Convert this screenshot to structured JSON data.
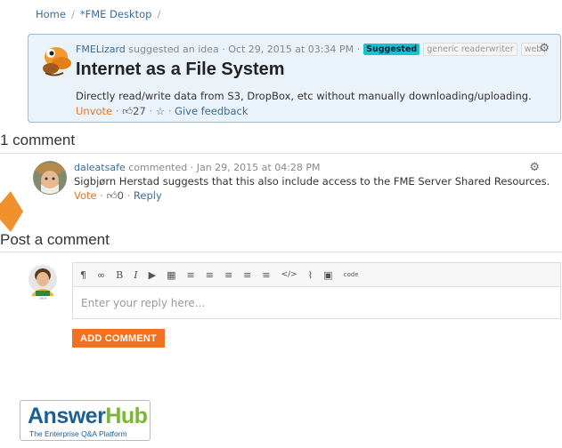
{
  "breadcrumb": {
    "home": "Home",
    "separator": "/",
    "current": "*FME Desktop"
  },
  "idea": {
    "author": "FMELizard",
    "action_text": "suggested an idea · Oct 29, 2015 at 03:34 PM ·",
    "status": "Suggested",
    "tags": [
      "generic readerwriter",
      "web"
    ],
    "title": "Internet as a File System",
    "description": "Directly read/write data from S3, DropBox, etc without manually downloading/uploading.",
    "unvote_label": "Unvote",
    "dot": "·",
    "votes": "27",
    "feedback_label": "Give feedback",
    "avatar_icon": "lizard-mascot-avatar",
    "colors": {
      "card_bg": "#eaf2fa",
      "card_border": "#9bbbd6",
      "status_bg": "#1fbfd0"
    }
  },
  "comments": {
    "heading": "1 comment",
    "items": [
      {
        "author": "daleatsafe",
        "meta": "commented · Jan 29, 2015 at 04:28 PM",
        "body": "Sigbjørn Herstad suggests that this also include access to the FME Server Shared Resources.",
        "vote_label": "Vote",
        "votes": "0",
        "reply_label": "Reply"
      }
    ]
  },
  "post": {
    "heading": "Post a comment",
    "placeholder": "Enter your reply here...",
    "submit_label": "ADD COMMENT",
    "toolbar": {
      "paragraph": "¶",
      "link": "∞",
      "bold": "B",
      "italic": "I",
      "video": "▶",
      "table": "▦",
      "bullets": "≡",
      "numbers": "≡",
      "align": "≡",
      "outdent": "≡",
      "indent": "≡",
      "code": "</>",
      "attach": "⌇",
      "image": "▣",
      "source": "code"
    }
  },
  "logo": {
    "answer": "Answer",
    "hub": "Hub",
    "tagline": "The Enterprise Q&A Platform"
  },
  "colors": {
    "accent_orange": "#f37021",
    "link_blue": "#3a6d99",
    "logo_blue": "#1c5f94",
    "logo_green": "#79b833"
  }
}
